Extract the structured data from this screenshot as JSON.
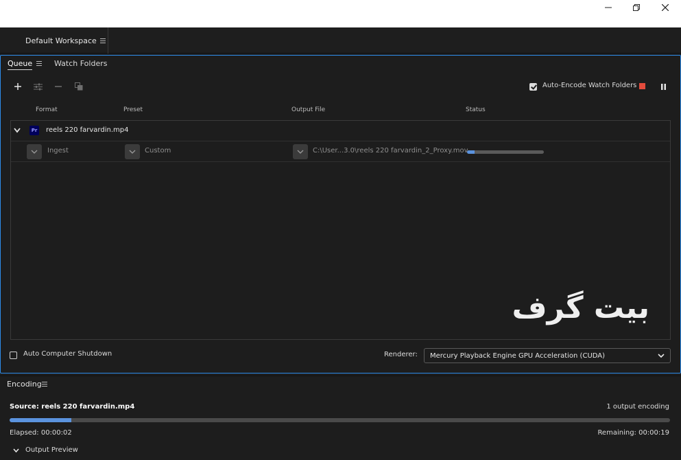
{
  "window": {
    "minimize_icon": "minimize-icon",
    "restore_icon": "restore-icon",
    "close_icon": "close-icon"
  },
  "workspace": {
    "label": "Default Workspace"
  },
  "queue": {
    "tabs": [
      {
        "label": "Queue"
      },
      {
        "label": "Watch Folders"
      }
    ],
    "auto_encode_label": "Auto-Encode Watch Folders",
    "auto_encode_checked": true,
    "columns": {
      "format": "Format",
      "preset": "Preset",
      "output": "Output File",
      "status": "Status"
    },
    "source": {
      "name": "reels 220 farvardin.mp4",
      "icon_text": "Pr"
    },
    "output": {
      "format": "Ingest",
      "preset": "Custom",
      "file": "C:\\User...3.0\\reels 220 farvardin_2_Proxy.mov",
      "progress": 0.1
    },
    "watermark": "بیت گرف",
    "auto_shutdown_label": "Auto Computer Shutdown",
    "renderer_label": "Renderer:",
    "renderer_value": "Mercury Playback Engine GPU Acceleration (CUDA)"
  },
  "encoding": {
    "title": "Encoding",
    "source": "Source: reels 220 farvardin.mp4",
    "output_count": "1 output encoding",
    "progress": 0.093,
    "elapsed": "Elapsed: 00:00:02",
    "remaining": "Remaining: 00:00:19",
    "output_preview": "Output Preview"
  },
  "colors": {
    "accent": "#2d8ceb",
    "progress": "#5b93de",
    "stop": "#e34b3c",
    "premiere_bg": "#00005b"
  }
}
